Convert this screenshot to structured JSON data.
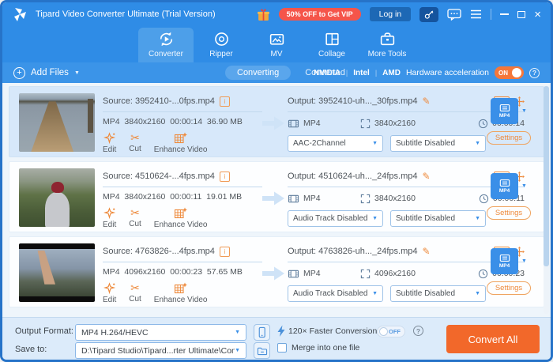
{
  "titlebar": {
    "title": "Tipard Video Converter Ultimate (Trial Version)",
    "promo": "50% OFF to Get VIP",
    "login": "Log in"
  },
  "nav": {
    "tabs": [
      "Converter",
      "Ripper",
      "MV",
      "Collage",
      "More Tools"
    ]
  },
  "toolbar": {
    "add_files": "Add Files",
    "converting": "Converting",
    "converted": "Converted",
    "brands": [
      "NVIDIA",
      "Intel",
      "AMD"
    ],
    "hw_label": "Hardware acceleration",
    "hw_state": "ON"
  },
  "rows": [
    {
      "source": "Source: 3952410-...0fps.mp4",
      "meta": "MP4  3840x2160  00:00:14  36.90 MB",
      "actions": [
        "Edit",
        "Cut",
        "Enhance Video"
      ],
      "output": "Output: 3952410-uh..._30fps.mp4",
      "out_format": "MP4",
      "out_res": "3840x2160",
      "out_dur": "00:00:14",
      "audio": "AAC-2Channel",
      "subtitle": "Subtitle Disabled",
      "profile": "MP4",
      "settings": "Settings",
      "selected": true,
      "thumb": "pier"
    },
    {
      "source": "Source: 4510624-...4fps.mp4",
      "meta": "MP4  3840x2160  00:00:11  19.01 MB",
      "actions": [
        "Edit",
        "Cut",
        "Enhance Video"
      ],
      "output": "Output: 4510624-uh..._24fps.mp4",
      "out_format": "MP4",
      "out_res": "3840x2160",
      "out_dur": "00:00:11",
      "audio": "Audio Track Disabled",
      "subtitle": "Subtitle Disabled",
      "profile": "MP4",
      "settings": "Settings",
      "selected": false,
      "thumb": "hiker"
    },
    {
      "source": "Source: 4763826-...4fps.mp4",
      "meta": "MP4  4096x2160  00:00:23  57.65 MB",
      "actions": [
        "Edit",
        "Cut",
        "Enhance Video"
      ],
      "output": "Output: 4763826-uh..._24fps.mp4",
      "out_format": "MP4",
      "out_res": "4096x2160",
      "out_dur": "00:00:23",
      "audio": "Audio Track Disabled",
      "subtitle": "Subtitle Disabled",
      "profile": "MP4",
      "settings": "Settings",
      "selected": false,
      "thumb": "climber"
    }
  ],
  "footer": {
    "output_format_label": "Output Format:",
    "output_format_value": "MP4 H.264/HEVC",
    "save_to_label": "Save to:",
    "save_to_value": "D:\\Tipard Studio\\Tipard...rter Ultimate\\Converted",
    "faster_label": "120× Faster Conversion",
    "faster_state": "OFF",
    "merge_label": "Merge into one file",
    "convert_all": "Convert All"
  },
  "glyphs": {
    "cut": "✂",
    "pencil": "✎",
    "info": "i",
    "id3": "ID3",
    "help": "?",
    "close": "×",
    "caret": "▼",
    "plus": "+"
  },
  "colors": {
    "titlebar_blue": "#2f8ce6",
    "subbar_blue": "#3b94e8",
    "selected_row": "#d7e8fa",
    "accent_orange": "#ee8a3c",
    "convert_orange": "#f2682a",
    "promo_red": "#f5554a"
  }
}
